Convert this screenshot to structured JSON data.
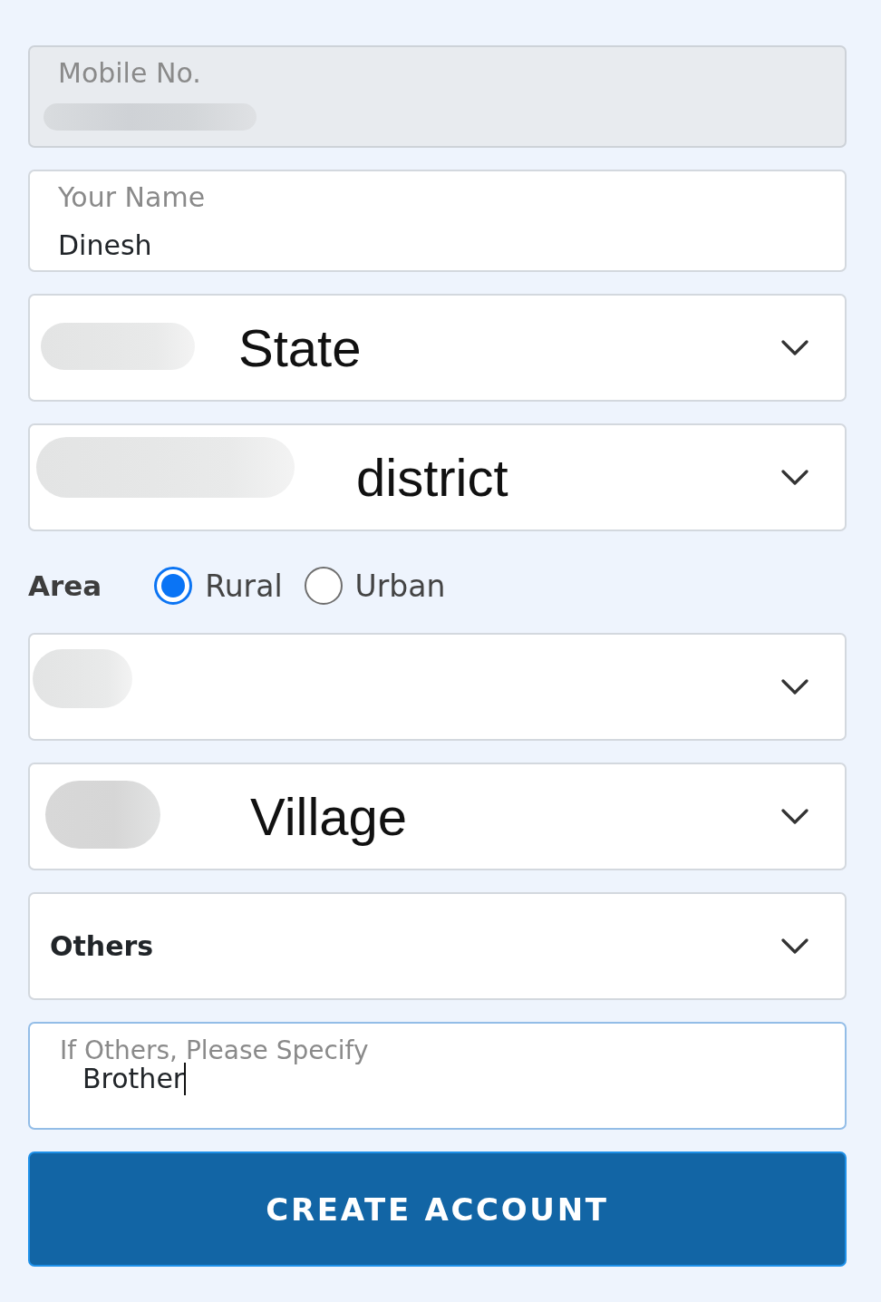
{
  "form": [
    {
      "kind": "text",
      "label": "Mobile No.",
      "disabled": true,
      "redacted": true
    },
    {
      "kind": "text",
      "label": "Your Name",
      "value": "Dinesh",
      "disabled": false,
      "redacted": false
    },
    {
      "kind": "picker",
      "value": "State",
      "redacted": true
    },
    {
      "kind": "picker",
      "value": "district",
      "redacted": true
    },
    {
      "kind": "radios",
      "label": "Area",
      "options": [
        {
          "label": "Rural",
          "selected": true
        },
        {
          "label": "Urban",
          "selected": false
        }
      ]
    },
    {
      "kind": "picker",
      "redacted": true
    },
    {
      "kind": "picker",
      "value": "Village",
      "redacted": true
    },
    {
      "kind": "select",
      "value": "Others"
    },
    {
      "kind": "floating",
      "label": "If Others, Please Specify",
      "value": "Brother",
      "focused": true
    }
  ],
  "submit": {
    "label": "CREATE ACCOUNT"
  }
}
